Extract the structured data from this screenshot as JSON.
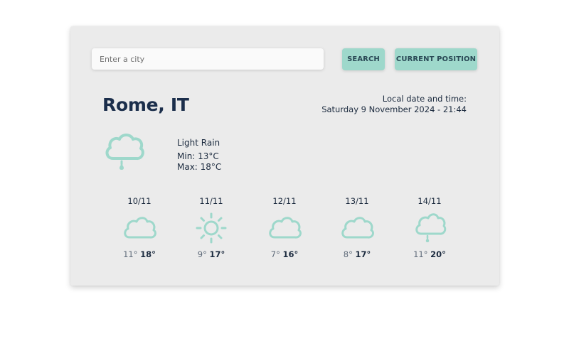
{
  "search": {
    "placeholder": "Enter a city",
    "value": "",
    "search_label": "SEARCH",
    "current_position_label": "CURRENT POSITION"
  },
  "location": {
    "city": "Rome, IT"
  },
  "local_time": {
    "label": "Local date and time:",
    "value": "Saturday 9 November 2024 - 21:44"
  },
  "current": {
    "icon": "rain-cloud-icon",
    "condition": "Light Rain",
    "min": "Min: 13°C",
    "max": "Max: 18°C"
  },
  "forecast": [
    {
      "date": "10/11",
      "icon": "cloud-icon",
      "min": "11°",
      "max": "18°"
    },
    {
      "date": "11/11",
      "icon": "sun-icon",
      "min": "9°",
      "max": "17°"
    },
    {
      "date": "12/11",
      "icon": "cloud-icon",
      "min": "7°",
      "max": "16°"
    },
    {
      "date": "13/11",
      "icon": "cloud-icon",
      "min": "8°",
      "max": "17°"
    },
    {
      "date": "14/11",
      "icon": "rain-cloud-icon",
      "min": "11°",
      "max": "20°"
    }
  ],
  "colors": {
    "accent": "#9ed8cb",
    "card_background": "#ebebeb",
    "title_text": "#1b2e4b"
  }
}
